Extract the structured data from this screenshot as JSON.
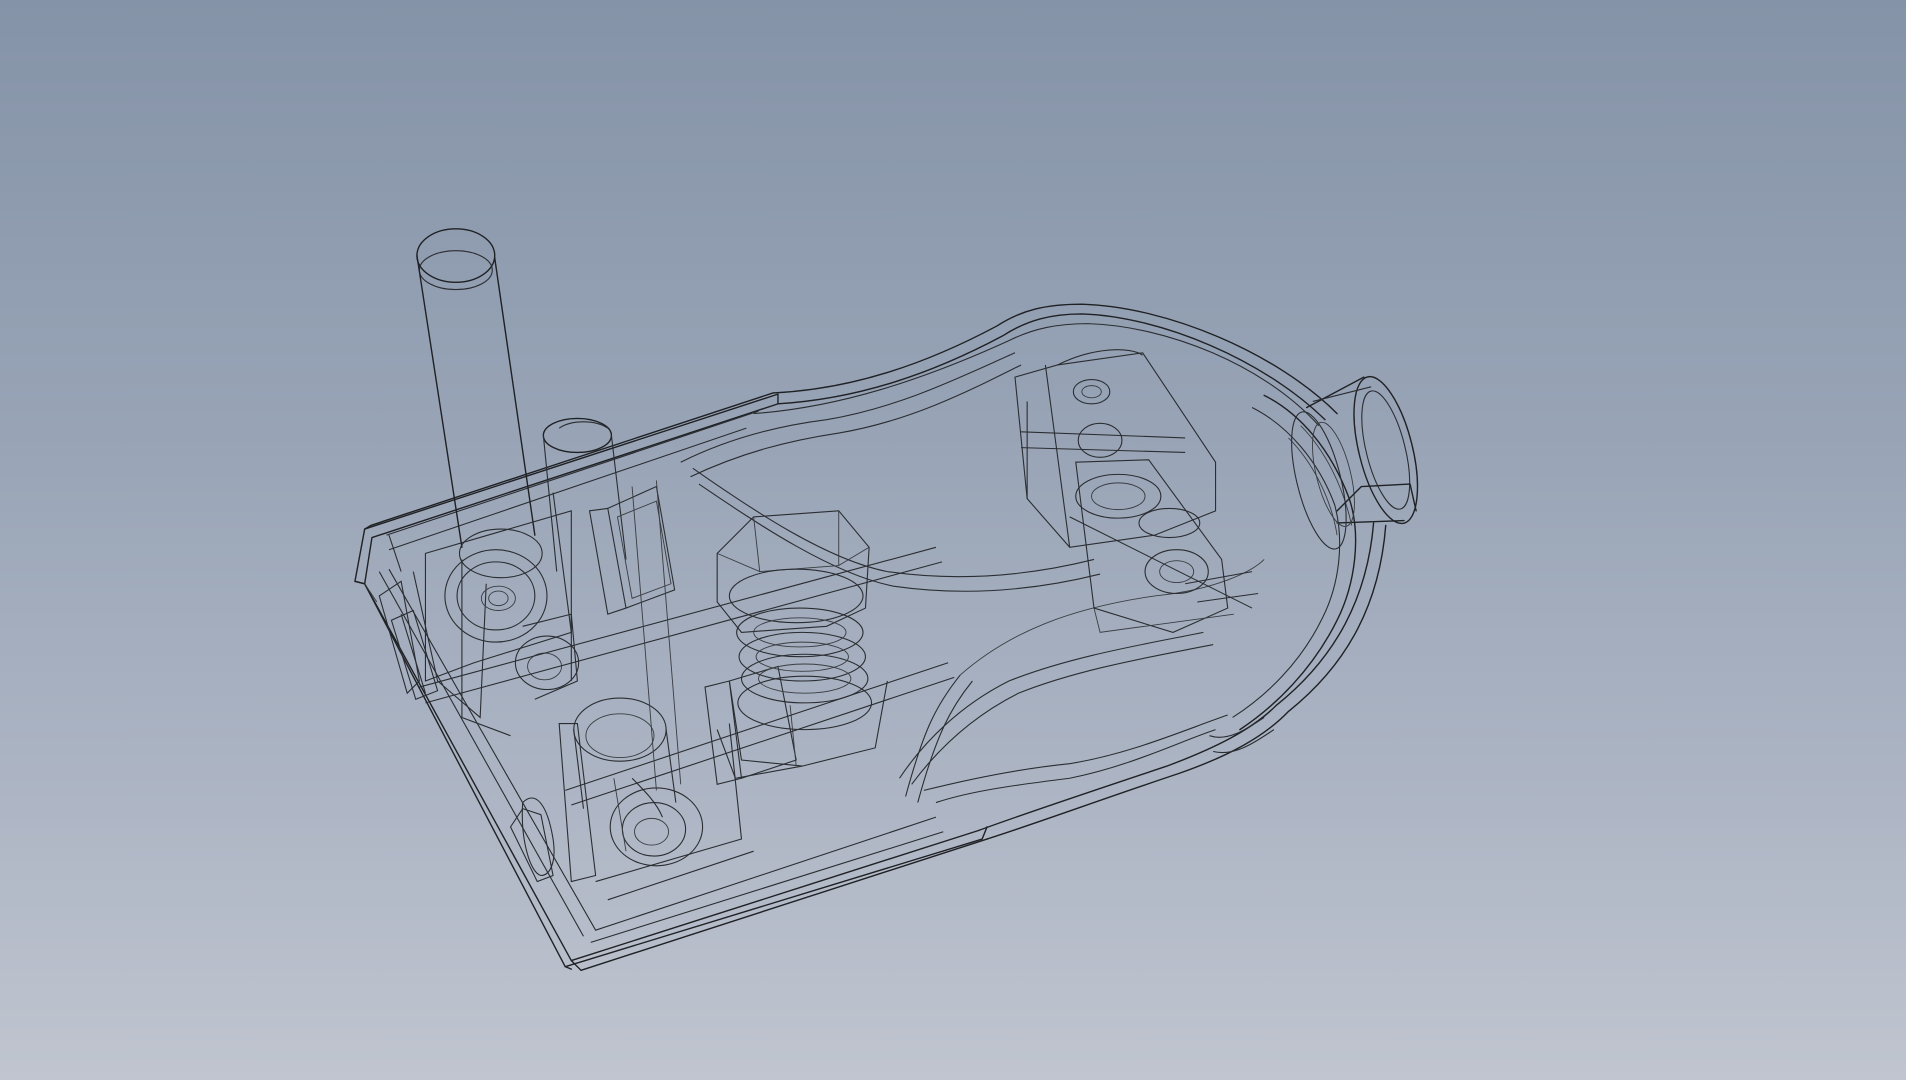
{
  "viewport": {
    "background_top": "#8593a8",
    "background_bottom": "#c0c5cf",
    "display_style": "wireframe",
    "edge_color": "#1f2124"
  },
  "model": {
    "description_visible_text": ""
  }
}
